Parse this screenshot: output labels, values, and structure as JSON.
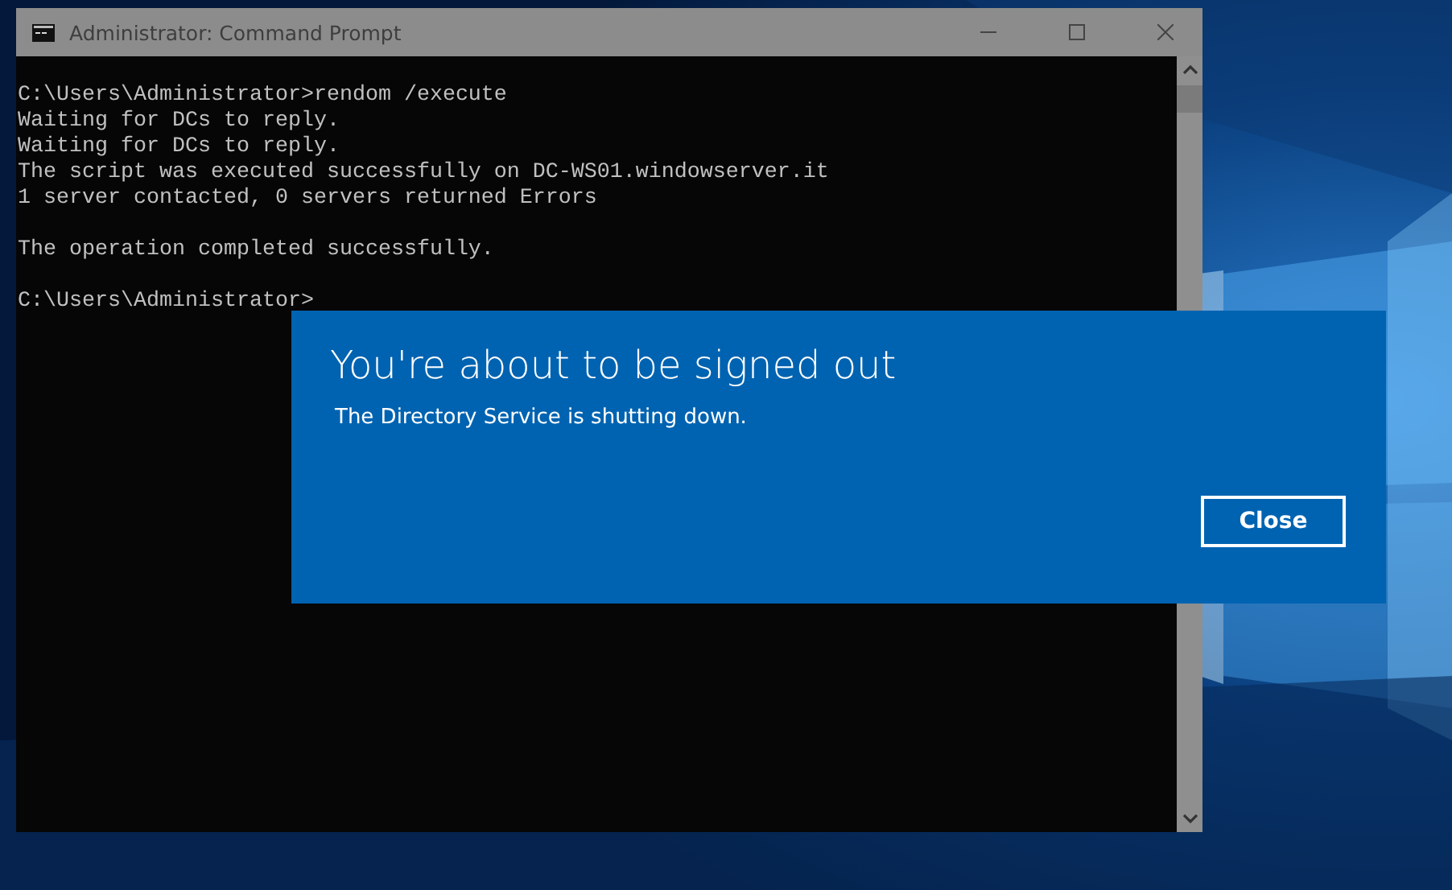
{
  "window": {
    "title": "Administrator: Command Prompt"
  },
  "console": {
    "blocks": [
      [
        "C:\\Users\\Administrator>rendom /execute",
        "Waiting for DCs to reply.",
        "Waiting for DCs to reply.",
        "The script was executed successfully on DC-WS01.windowserver.it",
        "1 server contacted, 0 servers returned Errors"
      ],
      [
        "The operation completed successfully."
      ],
      [
        "C:\\Users\\Administrator>"
      ]
    ]
  },
  "dialog": {
    "title": "You're about to be signed out",
    "message": "The Directory Service is shutting down.",
    "button": "Close"
  }
}
